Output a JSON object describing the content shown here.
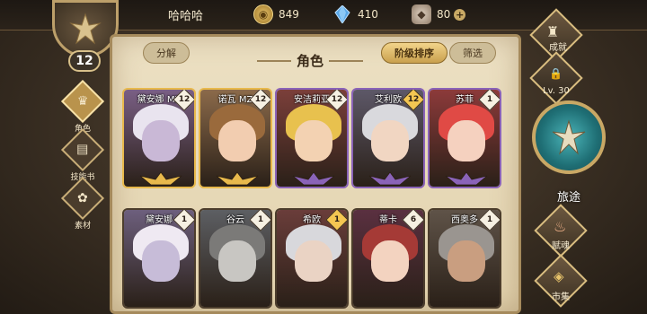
{
  "player": {
    "name": "哈哈哈",
    "level": "12"
  },
  "resources": {
    "gold": {
      "value": "849",
      "icon": "gold-coin-icon"
    },
    "crystal": {
      "value": "410",
      "icon": "blue-crystal-icon"
    },
    "stone": {
      "value": "80",
      "icon": "stone-icon",
      "plus": "+"
    }
  },
  "leftnav": [
    {
      "label": "角色",
      "icon": "character-icon",
      "active": true
    },
    {
      "label": "技能书",
      "icon": "skillbook-icon",
      "active": false
    },
    {
      "label": "素材",
      "icon": "material-icon",
      "active": false
    }
  ],
  "panel": {
    "title": "角色",
    "decompose_label": "分解",
    "sort_label": "阶级排序",
    "filter_label": "筛选"
  },
  "cards": [
    {
      "name": "黛安娜 MZ",
      "count": "12",
      "countGold": false,
      "rank": "gold",
      "skin": "#c9b8d6",
      "hair": "#e9e4ef",
      "bg": "#7a5f85"
    },
    {
      "name": "诺瓦 MZ",
      "count": "12",
      "countGold": false,
      "rank": "gold",
      "skin": "#f2cdb0",
      "hair": "#9a6a3c",
      "bg": "#8b6a4a"
    },
    {
      "name": "安洁莉亚",
      "count": "12",
      "countGold": false,
      "rank": "purple",
      "skin": "#f3d2b2",
      "hair": "#e8c14e",
      "bg": "#7b3f3a"
    },
    {
      "name": "艾利欧",
      "count": "12",
      "countGold": true,
      "rank": "purple",
      "skin": "#f1d6c2",
      "hair": "#d9d9dd",
      "bg": "#5d5868"
    },
    {
      "name": "苏菲",
      "count": "1",
      "countGold": false,
      "rank": "purple",
      "skin": "#f5d1bf",
      "hair": "#e04a45",
      "bg": "#8c3a3a"
    },
    {
      "name": "黛安娜",
      "count": "1",
      "countGold": false,
      "rank": "none",
      "skin": "#c7bcd8",
      "hair": "#efe9f2",
      "bg": "#6d5f7d"
    },
    {
      "name": "谷云",
      "count": "1",
      "countGold": false,
      "rank": "none",
      "skin": "#c8c6c2",
      "hair": "#7b7a78",
      "bg": "#5d5f63"
    },
    {
      "name": "希欧",
      "count": "1",
      "countGold": true,
      "rank": "none",
      "skin": "#ead3c4",
      "hair": "#d8d8dc",
      "bg": "#6a3d3a"
    },
    {
      "name": "蒂卡",
      "count": "6",
      "countGold": false,
      "rank": "none",
      "skin": "#f3d3c0",
      "hair": "#a53a36",
      "bg": "#5a3040"
    },
    {
      "name": "西奥多",
      "count": "1",
      "countGold": false,
      "rank": "none",
      "skin": "#c99e80",
      "hair": "#9a9590",
      "bg": "#5f5348"
    }
  ],
  "rightnav": {
    "achievement_label": "成就",
    "lock_level": "Lv. 30",
    "journey_label": "旅途",
    "talent_label": "赋魂",
    "market_label": "市集"
  }
}
